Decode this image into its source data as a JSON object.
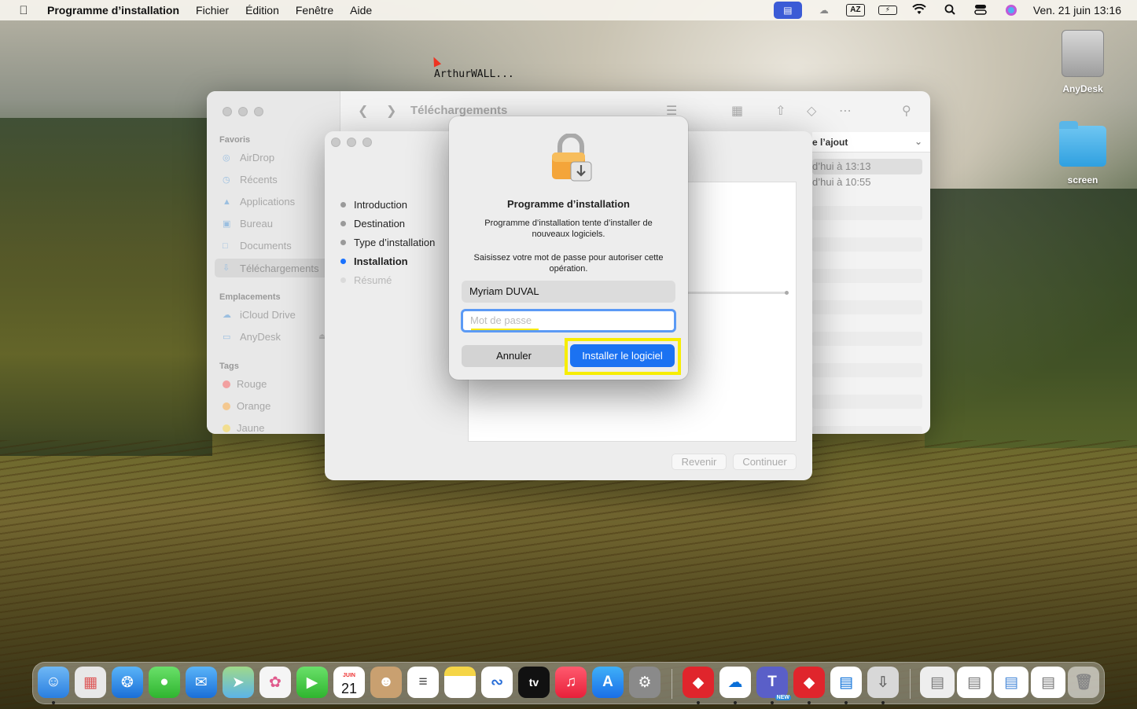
{
  "menubar": {
    "app_name": "Programme d’installation",
    "items": [
      "Fichier",
      "Édition",
      "Fenêtre",
      "Aide"
    ],
    "clock": "Ven. 21 juin  13:16",
    "input_source": "AZ"
  },
  "remote_label": "ArthurWALL...",
  "desktop": {
    "icons": [
      {
        "label": "AnyDesk",
        "icon": "drive-icon"
      },
      {
        "label": "screen",
        "icon": "folder-icon"
      }
    ]
  },
  "finder": {
    "title": "Téléchargements",
    "sidebar": {
      "favorites_header": "Favoris",
      "favorites": [
        "AirDrop",
        "Récents",
        "Applications",
        "Bureau",
        "Documents",
        "Téléchargements"
      ],
      "locations_header": "Emplacements",
      "locations": [
        "iCloud Drive",
        "AnyDesk"
      ],
      "tags_header": "Tags",
      "tags": [
        {
          "label": "Rouge",
          "color": "#f26c6c"
        },
        {
          "label": "Orange",
          "color": "#f5a94a"
        },
        {
          "label": "Jaune",
          "color": "#f2d14a"
        }
      ]
    },
    "sort_label": "e l’ajout",
    "rows": [
      "d’hui à 13:13",
      "d’hui à 10:55"
    ]
  },
  "installer": {
    "steps": [
      {
        "label": "Introduction",
        "state": "done"
      },
      {
        "label": "Destination",
        "state": "done"
      },
      {
        "label": "Type d’installation",
        "state": "done"
      },
      {
        "label": "Installation",
        "state": "current"
      },
      {
        "label": "Résumé",
        "state": "pending"
      }
    ],
    "back_label": "Revenir",
    "continue_label": "Continuer"
  },
  "auth_dialog": {
    "title": "Programme d’installation",
    "message": "Programme d’installation tente d’installer de nouveaux logiciels.",
    "prompt": "Saisissez votre mot de passe pour autoriser cette opération.",
    "username": "Myriam DUVAL",
    "password_placeholder": "Mot de passe",
    "cancel_label": "Annuler",
    "install_label": "Installer le logiciel"
  },
  "dock": {
    "calendar_month": "JUIN",
    "calendar_day": "21",
    "tv_label": "tv",
    "teams_badge": "NEW"
  }
}
